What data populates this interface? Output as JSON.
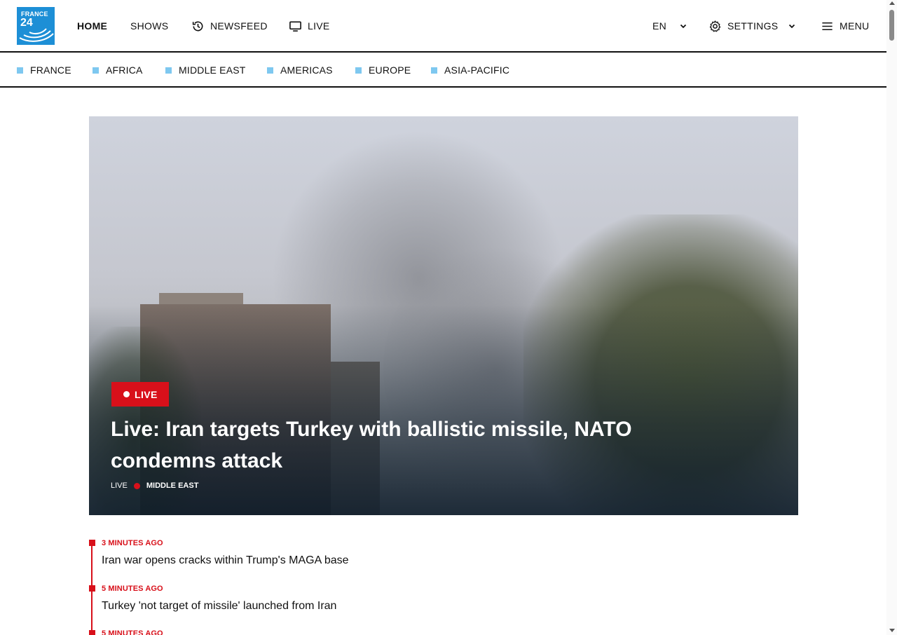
{
  "header": {
    "logo": {
      "line1": "FRANCE",
      "line2": "24"
    },
    "nav": {
      "home": "HOME",
      "shows": "SHOWS",
      "newsfeed": "NEWSFEED",
      "live": "LIVE"
    },
    "language": "EN",
    "settings": "SETTINGS",
    "menu": "MENU"
  },
  "regions": [
    "FRANCE",
    "AFRICA",
    "MIDDLE EAST",
    "AMERICAS",
    "EUROPE",
    "ASIA-PACIFIC"
  ],
  "hero": {
    "badge": "LIVE",
    "title": "Live: Iran targets Turkey with ballistic missile, NATO condemns attack",
    "meta_type": "LIVE",
    "meta_region": "MIDDLE EAST"
  },
  "feed": [
    {
      "time": "3 MINUTES AGO",
      "headline": "Iran war opens cracks within Trump's MAGA base"
    },
    {
      "time": "5 MINUTES AGO",
      "headline": "Turkey 'not target of missile' launched from Iran"
    },
    {
      "time": "5 MINUTES AGO",
      "headline": ""
    }
  ],
  "colors": {
    "accent_red": "#d8101a",
    "logo_blue": "#1d8fd6",
    "region_square": "#7ec8f0"
  }
}
